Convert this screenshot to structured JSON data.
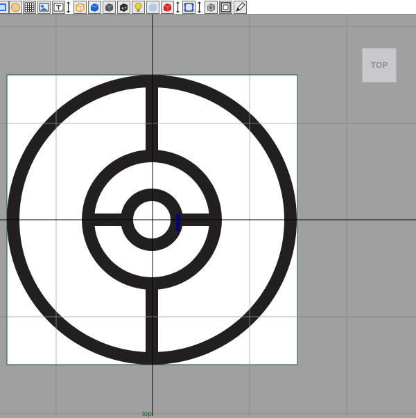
{
  "toolbar": {
    "buttons": [
      {
        "name": "select-icon",
        "color": "#3a6fd8"
      },
      {
        "name": "sphere-icon",
        "color": "#f2c98e"
      },
      {
        "name": "grid-icon",
        "color": "#333333"
      },
      {
        "name": "image-plane-icon",
        "color": "#3a6fd8"
      },
      {
        "name": "text-icon",
        "color": "#333333"
      },
      {
        "name": "wireframe-cube-icon",
        "color": "#f0a030"
      },
      {
        "name": "solid-cube-icon",
        "color": "#1f5fcf"
      },
      {
        "name": "shaded-cube-icon",
        "color": "#333333"
      },
      {
        "name": "textured-cube-icon",
        "color": "#333333"
      },
      {
        "name": "light-bulb-icon",
        "color": "#f2d23a"
      },
      {
        "name": "xray-cube-icon",
        "color": "#a9c7e8"
      },
      {
        "name": "red-cube-icon",
        "color": "#d02020"
      },
      {
        "name": "frame-select-icon",
        "color": "#1f3fcf"
      },
      {
        "name": "isolate-cube-icon",
        "color": "#555555"
      },
      {
        "name": "film-gate-icon",
        "color": "#222222"
      },
      {
        "name": "pen-icon",
        "color": "#222222"
      }
    ]
  },
  "viewport": {
    "view_cube_label": "TOP",
    "camera_label": "top",
    "background_color": "#a0a0a0",
    "grid_color": "#8a8a8a",
    "axis_color": "#000000",
    "image_plane_border": "#1a5a2a",
    "target_color": "#231f20",
    "pivot_color": "#000080"
  }
}
